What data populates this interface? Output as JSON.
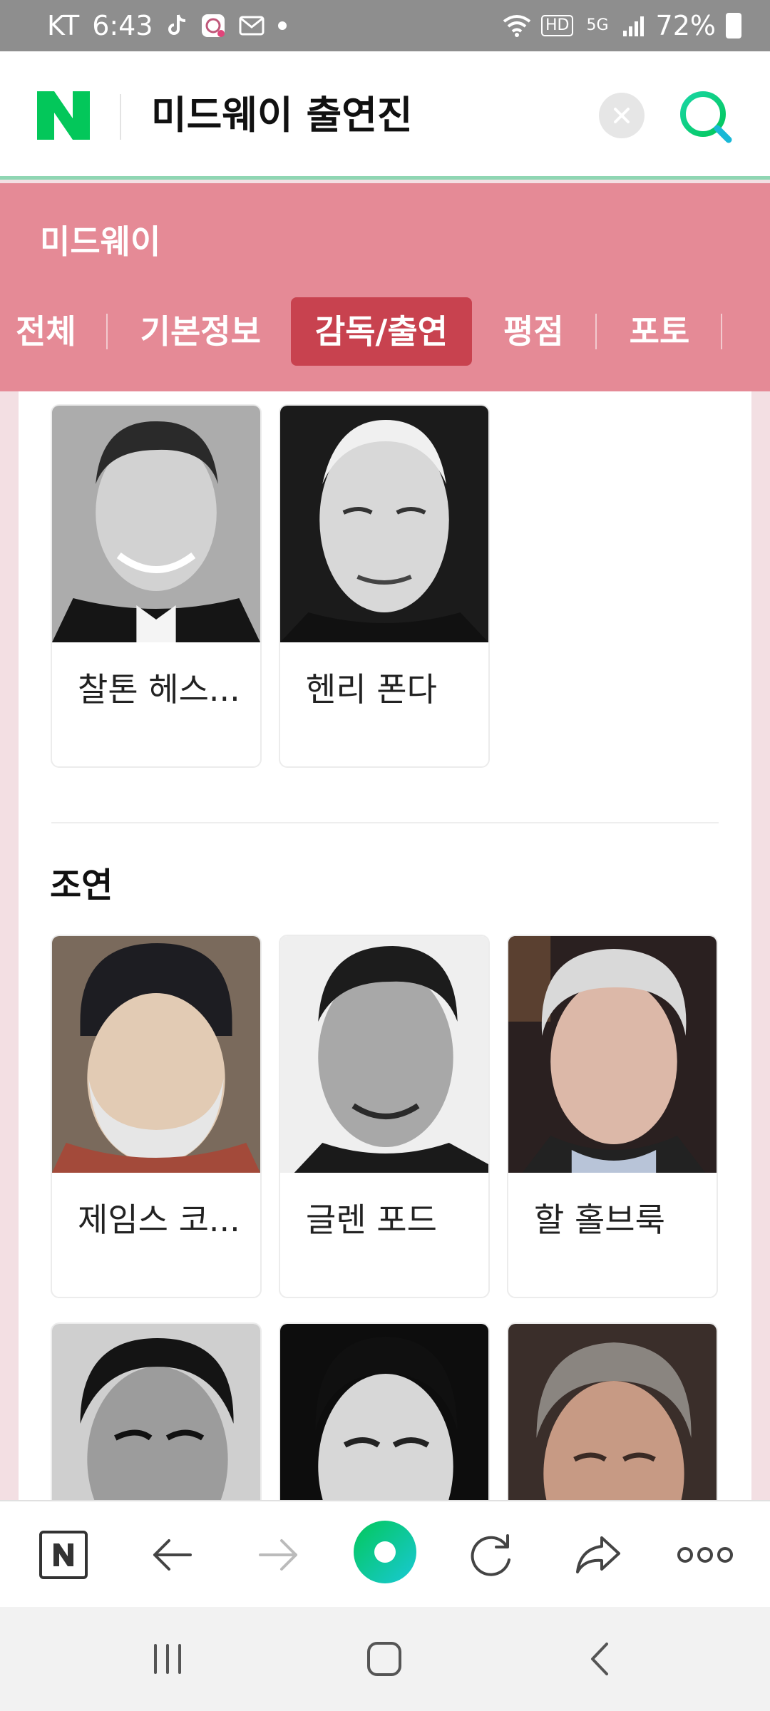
{
  "status_bar": {
    "carrier": "KT",
    "time": "6:43",
    "notification_icons": [
      "tiktok-icon",
      "app-notification-icon",
      "mail-icon",
      "dot-icon"
    ],
    "hd_label": "HD",
    "network_label": "5G",
    "battery": "72%"
  },
  "header": {
    "query": "미드웨이 출연진",
    "brand_color": "#03c75a"
  },
  "panel": {
    "title": "미드웨이",
    "tabs": [
      {
        "label": "전체",
        "active": false
      },
      {
        "label": "기본정보",
        "active": false
      },
      {
        "label": "감독/출연",
        "active": true
      },
      {
        "label": "평점",
        "active": false
      },
      {
        "label": "포토",
        "active": false
      }
    ],
    "background_color": "#e58a96",
    "active_tab_color": "#c8424f"
  },
  "main_cast": {
    "people": [
      {
        "name": "찰톤 헤스..."
      },
      {
        "name": "헨리 폰다"
      }
    ]
  },
  "supporting_cast": {
    "title": "조연",
    "people": [
      {
        "name": "제임스 코..."
      },
      {
        "name": "글렌 포드"
      },
      {
        "name": "할 홀브룩"
      },
      {
        "name": ""
      },
      {
        "name": ""
      },
      {
        "name": ""
      }
    ]
  },
  "toolbar": {
    "items": [
      "naver-home-icon",
      "back-arrow-icon",
      "forward-arrow-icon",
      "green-dot-icon",
      "refresh-icon",
      "share-icon",
      "more-icon"
    ]
  },
  "android_nav": {
    "items": [
      "recent-apps-icon",
      "home-icon",
      "back-icon"
    ]
  }
}
